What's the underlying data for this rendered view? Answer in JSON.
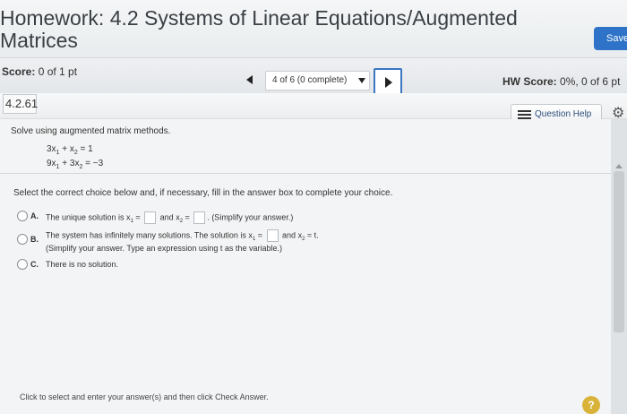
{
  "header": {
    "title_line1": "Homework: 4.2 Systems of Linear Equations/Augmented",
    "title_line2": "Matrices",
    "save_label": "Save"
  },
  "score_bar": {
    "score_label": "Score:",
    "score_value": "0 of 1 pt",
    "progress_text": "4 of 6 (0 complete)",
    "hw_score_label": "HW Score:",
    "hw_score_value": "0%, 0 of 6 pt"
  },
  "question_bar": {
    "number": "4.2.61",
    "help_label": "Question Help"
  },
  "question": {
    "instruction": "Solve using augmented matrix methods.",
    "equations": [
      {
        "a": "3x",
        "s1": "1",
        "op": " + ",
        "b": "x",
        "s2": "2",
        "rhs": " =  1"
      },
      {
        "a": "9x",
        "s1": "1",
        "op": " + 3",
        "b": "x",
        "s2": "2",
        "rhs": " = −3"
      }
    ],
    "select_instruction": "Select the correct choice below and, if necessary, fill in the answer box to complete your choice."
  },
  "options": {
    "a": {
      "letter": "A.",
      "pre": "The unique solution is x",
      "sub1": "1",
      "mid": " = ",
      "and": " and x",
      "sub2": "2",
      "eq2": " = ",
      "post": ". (Simplify your answer.)"
    },
    "b": {
      "letter": "B.",
      "line1": "The system has infinitely many solutions. The solution is x",
      "sub1": "1",
      "eq1": " = ",
      "and": " and x",
      "sub2": "2",
      "post": " = t.",
      "line2": "(Simplify your answer. Type an expression using t as the variable.)"
    },
    "c": {
      "letter": "C.",
      "text": "There is no solution."
    }
  },
  "footer": {
    "text": "Click to select and enter your answer(s) and then click Check Answer.",
    "help_symbol": "?"
  },
  "icons": {
    "prev": "left-triangle",
    "next": "right-triangle",
    "menu": "hamburger-icon",
    "settings": "gear-icon"
  }
}
